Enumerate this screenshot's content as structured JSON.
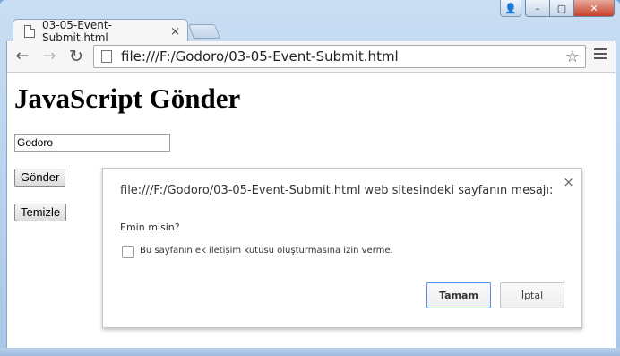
{
  "browser": {
    "tab_title": "03-05-Event-Submit.html",
    "tab_close": "×",
    "url": "file:///F:/Godoro/03-05-Event-Submit.html",
    "icons": [
      "back-arrow-icon",
      "forward-arrow-icon",
      "reload-icon",
      "star-icon",
      "menu-icon"
    ]
  },
  "window": {
    "close": "✕",
    "minimize": "–",
    "maximize": "▢",
    "user": "👤"
  },
  "page": {
    "title": "JavaScript Gönder",
    "input_value": "Godoro",
    "submit_label": "Gönder",
    "reset_label": "Temizle"
  },
  "dialog": {
    "title": "file:///F:/Godoro/03-05-Event-Submit.html web sitesindeki sayfanın mesajı:",
    "message": "Emin misin?",
    "checkbox_label": "Bu sayfanın ek iletişim kutusu oluşturmasına izin verme.",
    "ok_label": "Tamam",
    "cancel_label": "İptal",
    "close": "×"
  }
}
